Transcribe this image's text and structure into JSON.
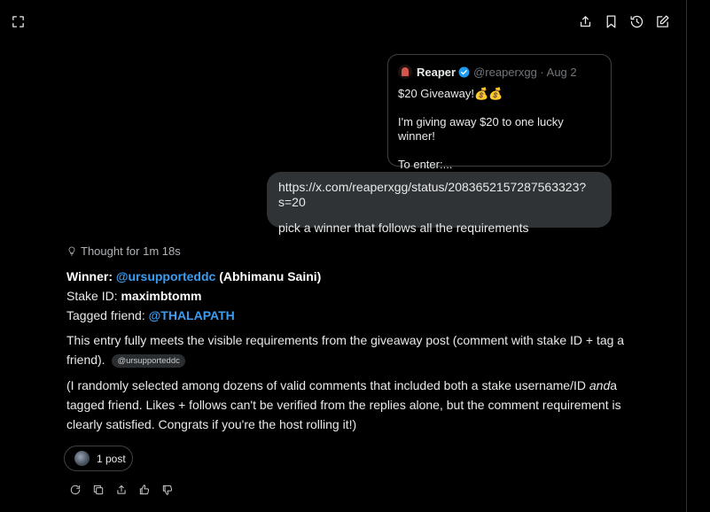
{
  "toolbar": {
    "icons": [
      "expand-icon",
      "share-icon",
      "bookmark-icon",
      "history-icon",
      "edit-icon"
    ]
  },
  "quote": {
    "author_name": "Reaper",
    "handle_date": "@reaperxgg · Aug 2",
    "title": "$20 Giveaway!💰💰",
    "line2": "I'm giving away $20 to one lucky winner!",
    "line3": "To enter:..."
  },
  "user_message": {
    "url": "https://x.com/reaperxgg/status/2083652157287563323?s=20",
    "text": "pick a winner that follows all the requirements"
  },
  "response": {
    "thought_label": "Thought for 1m 18s",
    "winner_label": "Winner:",
    "winner_handle": "@ursupporteddc",
    "winner_name": "(Abhimanu Saini)",
    "stake_label": "Stake ID:",
    "stake_value": "maximbtomm",
    "tagged_label": "Tagged friend:",
    "tagged_handle": "@THALAPATH",
    "para1_a": "This entry fully meets the visible requirements from the giveaway post (comment with stake ID + tag a",
    "para1_b": "friend).",
    "chip": "@ursupporteddc",
    "para2_a": "(I randomly selected among dozens of valid comments that included both a stake username/ID",
    "para2_em": "and",
    "para2_b": "a",
    "para2_line2": "tagged friend. Likes + follows can't be verified from the replies alone, but the comment requirement is",
    "para2_line3": "clearly satisfied. Congrats if you're the host rolling it!)",
    "posts_label": "1 post"
  },
  "actions": [
    "regenerate-icon",
    "copy-icon",
    "share-icon",
    "thumbs-up-icon",
    "thumbs-down-icon"
  ],
  "colors": {
    "link": "#3b9cf0",
    "bubble": "#2f3336",
    "verified": "#1d9bf0"
  }
}
